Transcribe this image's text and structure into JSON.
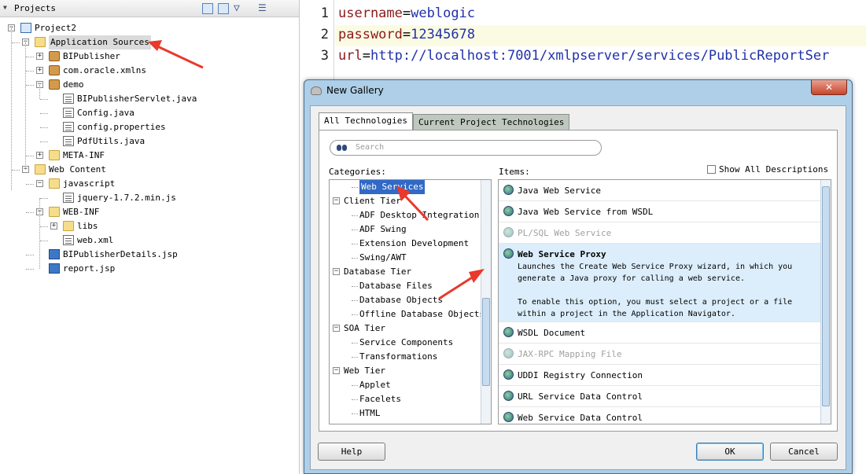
{
  "projects": {
    "title": "Projects",
    "tree": [
      {
        "label": "Project2",
        "icon": "project-icon",
        "depth": 0,
        "expander": "−"
      },
      {
        "label": "Application Sources",
        "icon": "folder-icon",
        "depth": 1,
        "expander": "−",
        "selected": true
      },
      {
        "label": "BIPublisher",
        "icon": "package-icon",
        "depth": 2,
        "expander": "+"
      },
      {
        "label": "com.oracle.xmlns",
        "icon": "package-icon",
        "depth": 2,
        "expander": "+"
      },
      {
        "label": "demo",
        "icon": "package-icon",
        "depth": 2,
        "expander": "−"
      },
      {
        "label": "BIPublisherServlet.java",
        "icon": "java-file-icon",
        "depth": 3,
        "expander": ""
      },
      {
        "label": "Config.java",
        "icon": "java-file-icon",
        "depth": 3,
        "expander": ""
      },
      {
        "label": "config.properties",
        "icon": "properties-file-icon",
        "depth": 3,
        "expander": ""
      },
      {
        "label": "PdfUtils.java",
        "icon": "java-file-icon",
        "depth": 3,
        "expander": ""
      },
      {
        "label": "META-INF",
        "icon": "folder-icon",
        "depth": 2,
        "expander": "+"
      },
      {
        "label": "Web Content",
        "icon": "folder-icon",
        "depth": 1,
        "expander": "−"
      },
      {
        "label": "javascript",
        "icon": "folder-icon",
        "depth": 2,
        "expander": "−"
      },
      {
        "label": "jquery-1.7.2.min.js",
        "icon": "js-file-icon",
        "depth": 3,
        "expander": ""
      },
      {
        "label": "WEB-INF",
        "icon": "folder-icon",
        "depth": 2,
        "expander": "−"
      },
      {
        "label": "libs",
        "icon": "folder-icon",
        "depth": 3,
        "expander": "+"
      },
      {
        "label": "web.xml",
        "icon": "xml-file-icon",
        "depth": 3,
        "expander": ""
      },
      {
        "label": "BIPublisherDetails.jsp",
        "icon": "jsp-file-icon",
        "depth": 2,
        "expander": ""
      },
      {
        "label": "report.jsp",
        "icon": "jsp-file-icon",
        "depth": 2,
        "expander": ""
      }
    ]
  },
  "editor": {
    "lines": [
      {
        "num": "1",
        "key": "username",
        "eq": "=",
        "value": "weblogic"
      },
      {
        "num": "2",
        "key": "password",
        "eq": "=",
        "value": "12345678"
      },
      {
        "num": "3",
        "key": "url",
        "eq": "=",
        "value": "http://localhost:7001/xmlpserver/services/PublicReportSer"
      }
    ]
  },
  "dialog": {
    "title": "New Gallery",
    "close": "✕",
    "tabs": [
      "All Technologies",
      "Current Project Technologies"
    ],
    "search_placeholder": "Search",
    "categories_label": "Categories:",
    "items_label": "Items:",
    "show_all": "Show All Descriptions",
    "categories": [
      {
        "label": "Web Services",
        "level": 2,
        "selected": true
      },
      {
        "label": "Client Tier",
        "level": 1,
        "expander": "−"
      },
      {
        "label": "ADF Desktop Integration",
        "level": 2
      },
      {
        "label": "ADF Swing",
        "level": 2
      },
      {
        "label": "Extension Development",
        "level": 2
      },
      {
        "label": "Swing/AWT",
        "level": 2
      },
      {
        "label": "Database Tier",
        "level": 1,
        "expander": "−"
      },
      {
        "label": "Database Files",
        "level": 2
      },
      {
        "label": "Database Objects",
        "level": 2
      },
      {
        "label": "Offline Database Objects",
        "level": 2
      },
      {
        "label": "SOA Tier",
        "level": 1,
        "expander": "−"
      },
      {
        "label": "Service Components",
        "level": 2
      },
      {
        "label": "Transformations",
        "level": 2
      },
      {
        "label": "Web Tier",
        "level": 1,
        "expander": "−"
      },
      {
        "label": "Applet",
        "level": 2
      },
      {
        "label": "Facelets",
        "level": 2
      },
      {
        "label": "HTML",
        "level": 2
      }
    ],
    "items": [
      {
        "label": "Java Web Service",
        "state": "normal"
      },
      {
        "label": "Java Web Service from WSDL",
        "state": "normal"
      },
      {
        "label": "PL/SQL Web Service",
        "state": "disabled"
      },
      {
        "label": "Web Service Proxy",
        "state": "selected",
        "desc": "Launches the Create Web Service Proxy wizard, in which you\ngenerate a Java proxy for calling a web service.\n\nTo enable this option, you must select a project or a file\nwithin a project in the Application Navigator."
      },
      {
        "label": "WSDL Document",
        "state": "normal"
      },
      {
        "label": "JAX-RPC Mapping File",
        "state": "disabled"
      },
      {
        "label": "UDDI Registry Connection",
        "state": "normal"
      },
      {
        "label": "URL Service Data Control",
        "state": "normal"
      },
      {
        "label": "Web Service Data Control",
        "state": "normal"
      }
    ],
    "buttons": {
      "help": "Help",
      "ok": "OK",
      "cancel": "Cancel"
    }
  },
  "colors": {
    "accent": "#3169c6",
    "annotation": "#e8392b",
    "keyword": "#8b1a1a",
    "value": "#2031a8"
  }
}
